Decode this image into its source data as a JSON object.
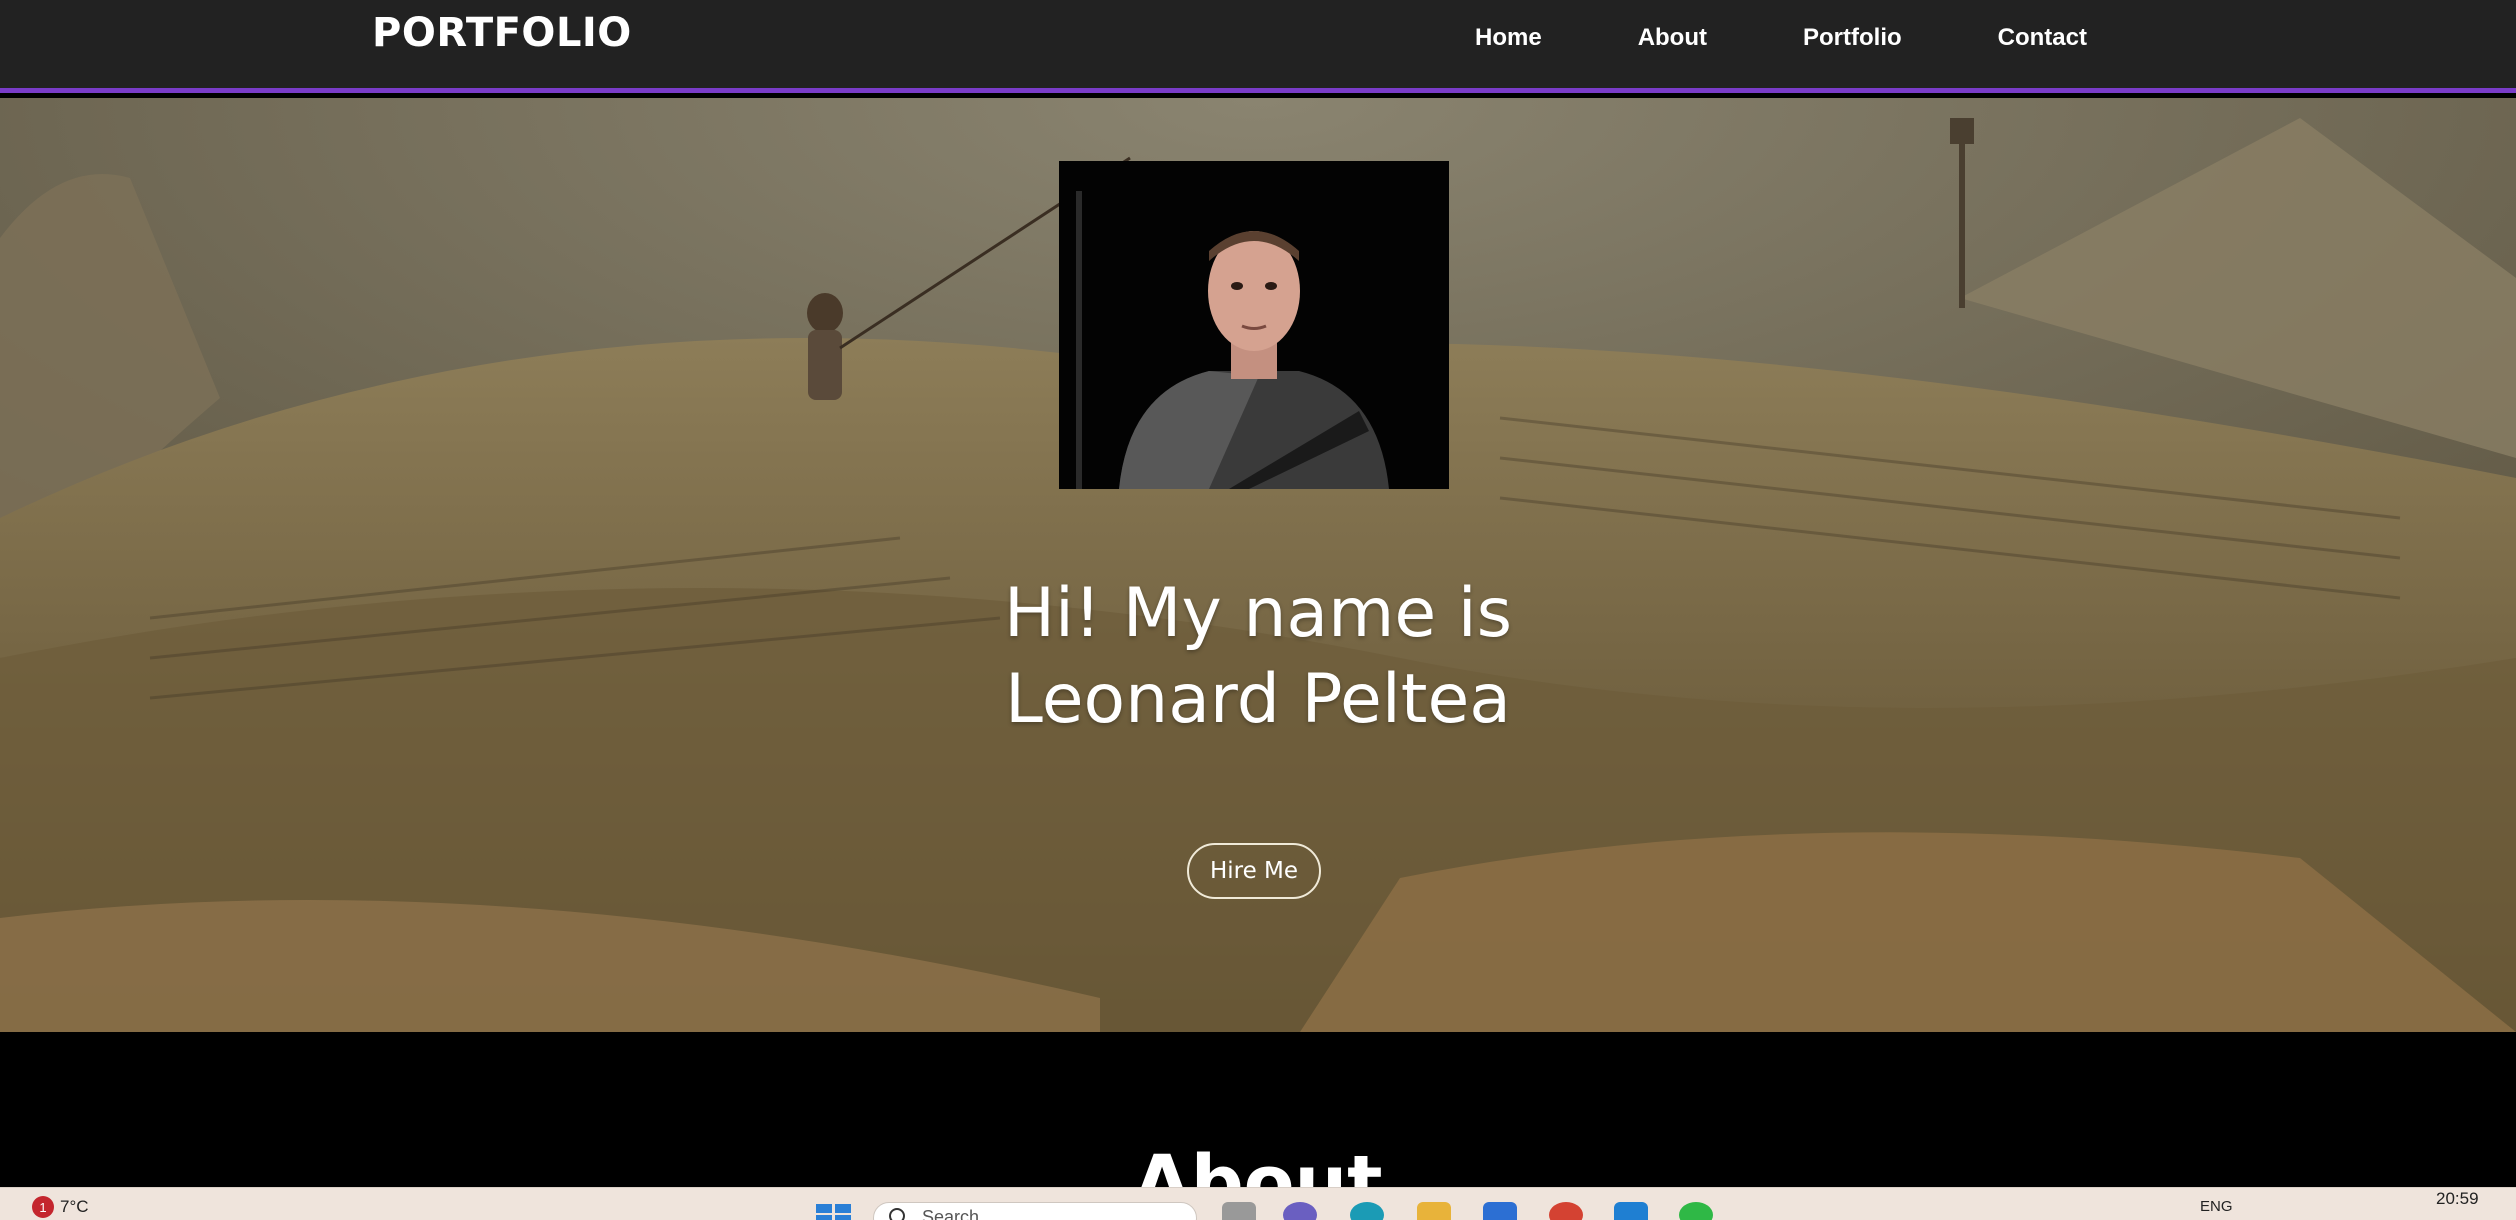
{
  "header": {
    "brand": "PORTFOLIO",
    "nav": [
      {
        "label": "Home"
      },
      {
        "label": "About"
      },
      {
        "label": "Portfolio"
      },
      {
        "label": "Contact"
      }
    ]
  },
  "hero": {
    "title_line1": "Hi! My name is",
    "title_line2": "Leonard Peltea",
    "cta": "Hire Me"
  },
  "about": {
    "heading": "About"
  },
  "taskbar": {
    "notification_count": "1",
    "temperature": "7°C",
    "search_placeholder": "Search",
    "language": "ENG",
    "time": "20:59"
  },
  "colors": {
    "navbar_bg": "#222222",
    "accent": "#7a3cc8",
    "hero_tint": "#6b5e3e",
    "section_bg": "#000000",
    "taskbar_bg": "#efe4dc"
  }
}
